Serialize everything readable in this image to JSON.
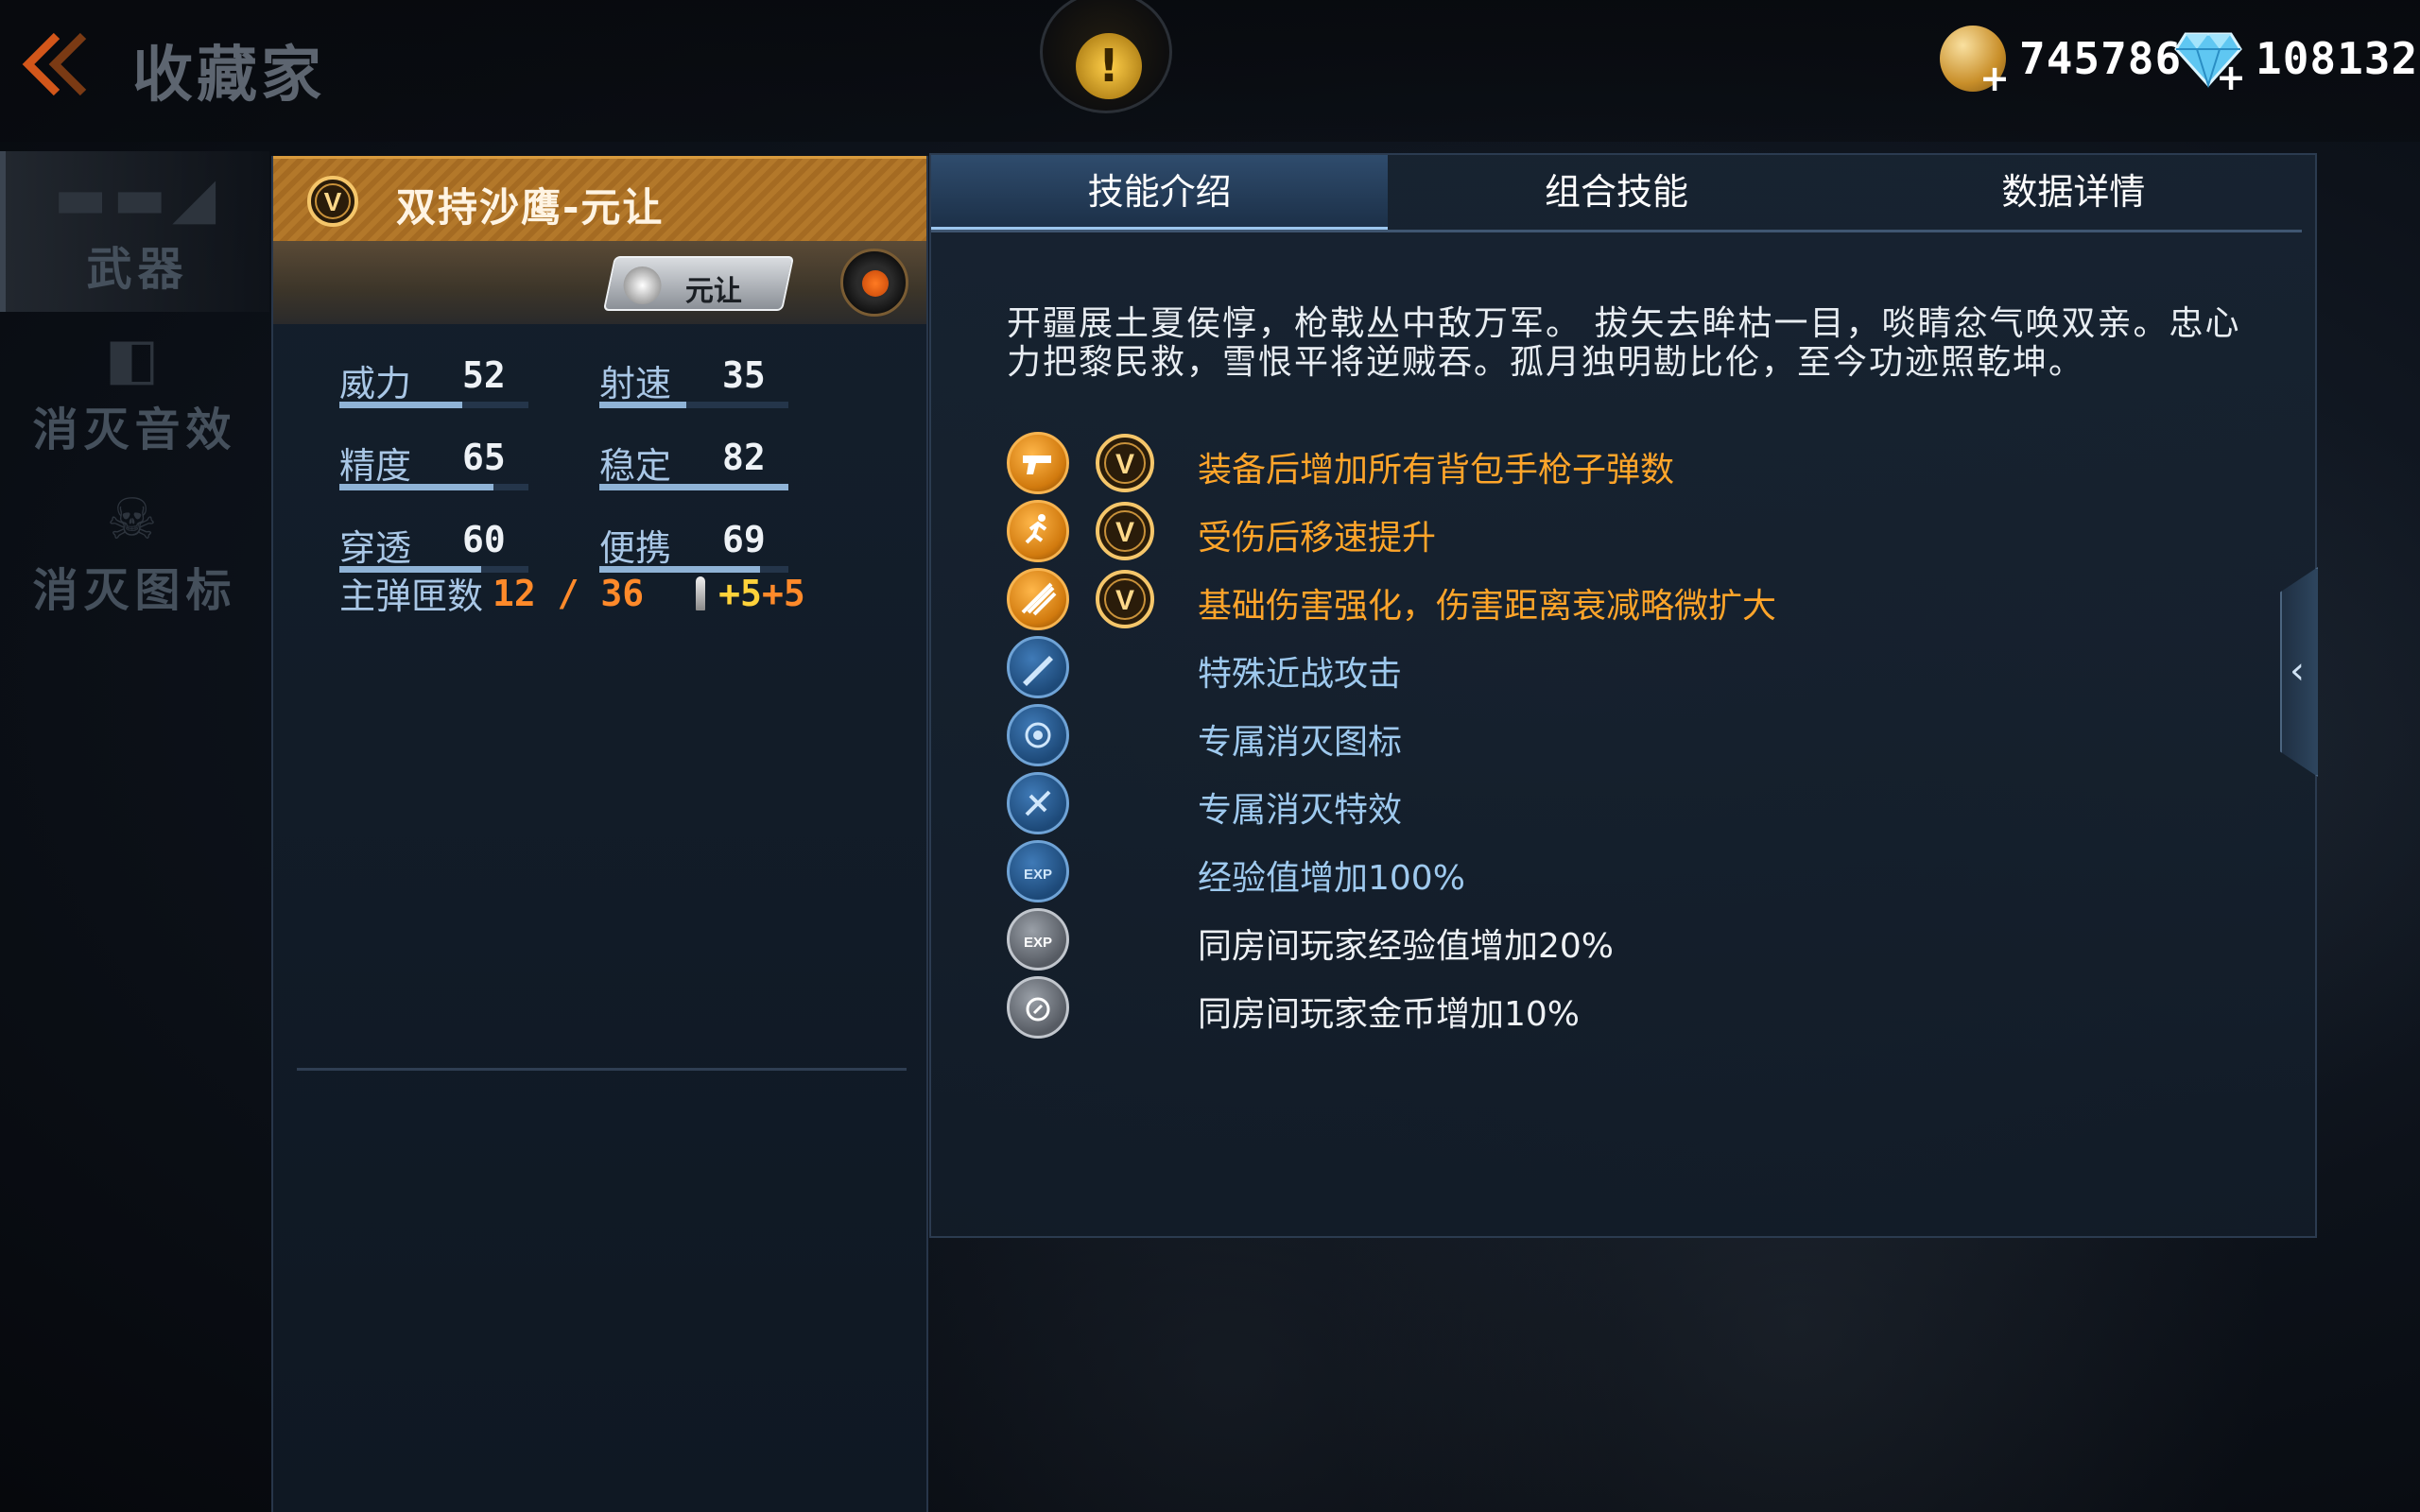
{
  "header": {
    "title": "收藏家"
  },
  "currency": {
    "coins": "745786",
    "diamonds": "108132"
  },
  "sidebar": {
    "items": [
      {
        "label": "武器"
      },
      {
        "label": "消灭音效"
      },
      {
        "label": "消灭图标"
      }
    ]
  },
  "weapon": {
    "badge": "V",
    "name": "双持沙鹰-元让",
    "tag": "元让",
    "stats": [
      {
        "label": "威力",
        "value": "52"
      },
      {
        "label": "射速",
        "value": "35"
      },
      {
        "label": "精度",
        "value": "65"
      },
      {
        "label": "稳定",
        "value": "82"
      },
      {
        "label": "穿透",
        "value": "60"
      },
      {
        "label": "便携",
        "value": "69"
      }
    ],
    "ammo_label": "主弹匣数",
    "ammo_value": "12 / 36",
    "ammo_bonus_1": "+5",
    "ammo_bonus_2": "+5"
  },
  "tabs": [
    {
      "label": "技能介绍"
    },
    {
      "label": "组合技能"
    },
    {
      "label": "数据详情"
    }
  ],
  "description": "开疆展土夏侯惇，枪戟丛中敌万军。 拔矢去眸枯一目，啖睛忿气唤双亲。忠心力把黎民救，雪恨平将逆贼吞。孤月独明勘比伦，至今功迹照乾坤。",
  "skills": [
    {
      "text": "装备后增加所有背包手枪子弹数",
      "icon": "pistol-icon"
    },
    {
      "text": "受伤后移速提升",
      "icon": "running-man-icon"
    },
    {
      "text": "基础伤害强化，伤害距离衰减略微扩大",
      "icon": "damage-icon"
    },
    {
      "text": "特殊近战攻击",
      "icon": "knife-icon"
    },
    {
      "text": "专属消灭图标",
      "icon": "kill-icon-icon"
    },
    {
      "text": "专属消灭特效",
      "icon": "kill-effect-icon"
    },
    {
      "text": "经验值增加100%",
      "icon": "exp-icon"
    },
    {
      "text": "同房间玩家经验值增加20%",
      "icon": "room-exp-icon"
    },
    {
      "text": "同房间玩家金币增加10%",
      "icon": "room-coin-icon"
    }
  ],
  "colors": {
    "gold": "#ffa52a",
    "ammo_orange": "#ff8a2a",
    "ammo_yellow": "#ffd23a",
    "tab_active": "#2f4c6d"
  }
}
